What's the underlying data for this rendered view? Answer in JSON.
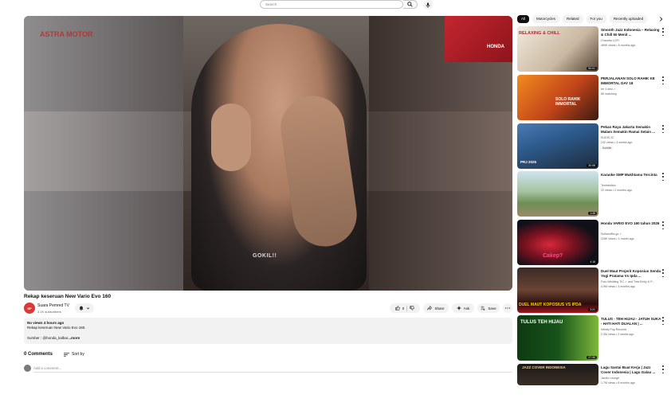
{
  "header": {
    "search_placeholder": "Search"
  },
  "video": {
    "caption_text": "GOKIL!!",
    "logo_left": "ASTRA MOTOR",
    "logo_right": "HONDA",
    "title": "Rekap keseruan New Vario Evo 160"
  },
  "channel": {
    "avatar_text": "SP",
    "name": "Suara Pemred TV",
    "subscribers": "3.1K subscribers"
  },
  "actions": {
    "like_count": "0",
    "share_label": "Share",
    "ask_label": "Ask",
    "save_label": "Save"
  },
  "description": {
    "meta": "No views  4 hours ago",
    "line1": "Rekap keseruan New Vario Evo 160.",
    "line2": "Sumber : @honda_kalbar",
    "more": "...more"
  },
  "comments": {
    "count_label": "0 Comments",
    "sort_label": "Sort by",
    "add_placeholder": "Add a comment..."
  },
  "chips": [
    "All",
    "Motorcycles",
    "Related",
    "For you",
    "Recently uploaded"
  ],
  "recommendations": [
    {
      "title": "Smooth Jazz Indonesia – Relaxing & Chill 50 Menit ...",
      "channel": "Chandra LOFI",
      "meta": "489K views • 8 months ago",
      "badge": "",
      "thumb_text": "RELAXING & CHILL",
      "duration": "50:01"
    },
    {
      "title": "PERJALANAN SOLO RAHIK KE IMMORTAL DAY 18",
      "channel": "tre 4 desi ✓",
      "meta": "8K watching",
      "badge": "",
      "thumb_text": "SOLO RAHIK IMMORTAL",
      "duration": ""
    },
    {
      "title": "Pekan Raya Jakarta Semakin Malam Semakin Ramai Selain ...",
      "channel": "KUDIS 22",
      "meta": "242 views • 3 weeks ago",
      "badge": "Subtitle",
      "thumb_text": "PRJ 2025",
      "duration": "30:08"
    },
    {
      "title": "Karaoke SMP Mukhtama Tercinta",
      "channel": "Tentrahilam",
      "meta": "22 views • 2 months ago",
      "badge": "",
      "thumb_text": "",
      "duration": "1:45"
    },
    {
      "title": "Honda VARIO EVO 160 tahun 2026",
      "channel": "SuBandRa.go ✓",
      "meta": "228K views • 1 month ago",
      "badge": "",
      "thumb_text": "Cakep?",
      "duration": "4:18"
    },
    {
      "title": "Duel Maut Projerit Koposius Senda Yogi Pratama Vs Ipda ...",
      "channel": "Foto Wedding TIC ✓ and Tirta Emily & P...",
      "meta": "4.9M views • 3 months ago",
      "badge": "",
      "thumb_text": "DUEL MAUT KOPOSIUS VS IPDA",
      "duration": "3:21"
    },
    {
      "title": "TULUS - TEH HIJAU - JATUH SUKA - HATI HATI DIJALAN | ...",
      "channel": "Infinity Pop Records",
      "meta": "2.3M views • 2 weeks ago",
      "badge": "",
      "thumb_text": "TULUS  TEH HIJAU",
      "duration": "27:30"
    },
    {
      "title": "Lagu Santai Buat Kerja | Jazz Cover Indonesia | Lagu Galau ...",
      "channel": "Jazzin Lounge",
      "meta": "1.7M views • 8 months ago",
      "badge": "",
      "thumb_text": "JAZZ COVER INDONESIA",
      "duration": ""
    }
  ]
}
